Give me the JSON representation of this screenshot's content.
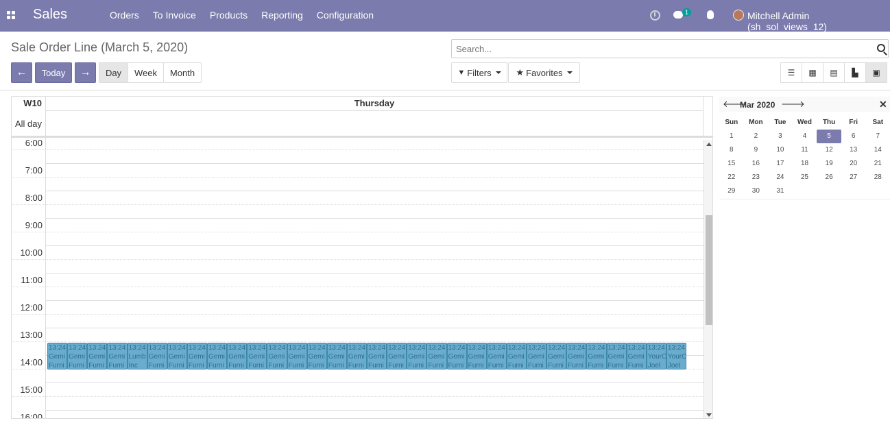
{
  "nav": {
    "brand": "Sales",
    "menu": [
      "Orders",
      "To Invoice",
      "Products",
      "Reporting",
      "Configuration"
    ],
    "chat_count": "1",
    "user": "Mitchell Admin (sh_sol_views_12)"
  },
  "control": {
    "title": "Sale Order Line (March 5, 2020)",
    "prev": "←",
    "today": "Today",
    "next": "→",
    "scale_day": "Day",
    "scale_week": "Week",
    "scale_month": "Month",
    "search_placeholder": "Search...",
    "filters": "Filters",
    "favorites": "Favorites"
  },
  "calendar": {
    "week": "W10",
    "day": "Thursday",
    "all_day": "All day",
    "hours": [
      "6:00",
      "7:00",
      "8:00",
      "9:00",
      "10:00",
      "11:00",
      "12:00",
      "13:00",
      "14:00",
      "15:00",
      "16:00"
    ],
    "events": [
      {
        "time": "13:24",
        "title": "Gemi",
        "sub": "Furni"
      },
      {
        "time": "13:24",
        "title": "Gemi",
        "sub": "Furni"
      },
      {
        "time": "13:24",
        "title": "Gemi",
        "sub": "Furni"
      },
      {
        "time": "13:24",
        "title": "Gemi",
        "sub": "Furni"
      },
      {
        "time": "13:24",
        "title": "Lumb",
        "sub": "Inc"
      },
      {
        "time": "13:24",
        "title": "Gemi",
        "sub": "Furni"
      },
      {
        "time": "13:24",
        "title": "Gemi",
        "sub": "Furni"
      },
      {
        "time": "13:24",
        "title": "Gemi",
        "sub": "Furni"
      },
      {
        "time": "13:24",
        "title": "Gemi",
        "sub": "Furni"
      },
      {
        "time": "13:24",
        "title": "Gemi",
        "sub": "Furni"
      },
      {
        "time": "13:24",
        "title": "Gemi",
        "sub": "Furni"
      },
      {
        "time": "13:24",
        "title": "Gemi",
        "sub": "Furni"
      },
      {
        "time": "13:24",
        "title": "Gemi",
        "sub": "Furni"
      },
      {
        "time": "13:24",
        "title": "Gemi",
        "sub": "Furni"
      },
      {
        "time": "13:24",
        "title": "Gemi",
        "sub": "Furni"
      },
      {
        "time": "13:24",
        "title": "Gemi",
        "sub": "Furni"
      },
      {
        "time": "13:24",
        "title": "Gemi",
        "sub": "Furni"
      },
      {
        "time": "13:24",
        "title": "Gemi",
        "sub": "Furni"
      },
      {
        "time": "13:24",
        "title": "Gemi",
        "sub": "Furni"
      },
      {
        "time": "13:24",
        "title": "Gemi",
        "sub": "Furni"
      },
      {
        "time": "13:24",
        "title": "Gemi",
        "sub": "Furni"
      },
      {
        "time": "13:24",
        "title": "Gemi",
        "sub": "Furni"
      },
      {
        "time": "13:24",
        "title": "Gemi",
        "sub": "Furni"
      },
      {
        "time": "13:24",
        "title": "Gemi",
        "sub": "Furni"
      },
      {
        "time": "13:24",
        "title": "Gemi",
        "sub": "Furni"
      },
      {
        "time": "13:24",
        "title": "Gemi",
        "sub": "Furni"
      },
      {
        "time": "13:24",
        "title": "Gemi",
        "sub": "Furni"
      },
      {
        "time": "13:24",
        "title": "Gemi",
        "sub": "Furni"
      },
      {
        "time": "13:24",
        "title": "Gemi",
        "sub": "Furni"
      },
      {
        "time": "13:24",
        "title": "Gemi",
        "sub": "Furni"
      },
      {
        "time": "13:24",
        "title": "YourC",
        "sub": "Joel"
      },
      {
        "time": "13:24",
        "title": "YourC",
        "sub": "Joel"
      }
    ]
  },
  "mini": {
    "title": "Mar 2020",
    "dow": [
      "Sun",
      "Mon",
      "Tue",
      "Wed",
      "Thu",
      "Fri",
      "Sat"
    ],
    "weeks": [
      [
        "1",
        "2",
        "3",
        "4",
        "5",
        "6",
        "7"
      ],
      [
        "8",
        "9",
        "10",
        "11",
        "12",
        "13",
        "14"
      ],
      [
        "15",
        "16",
        "17",
        "18",
        "19",
        "20",
        "21"
      ],
      [
        "22",
        "23",
        "24",
        "25",
        "26",
        "27",
        "28"
      ],
      [
        "29",
        "30",
        "31",
        "",
        "",
        "",
        ""
      ]
    ],
    "selected": "5"
  },
  "colors": {
    "brand": "#7c7bad",
    "event_bg": "#6aacce",
    "event_border": "#3e88aa"
  }
}
